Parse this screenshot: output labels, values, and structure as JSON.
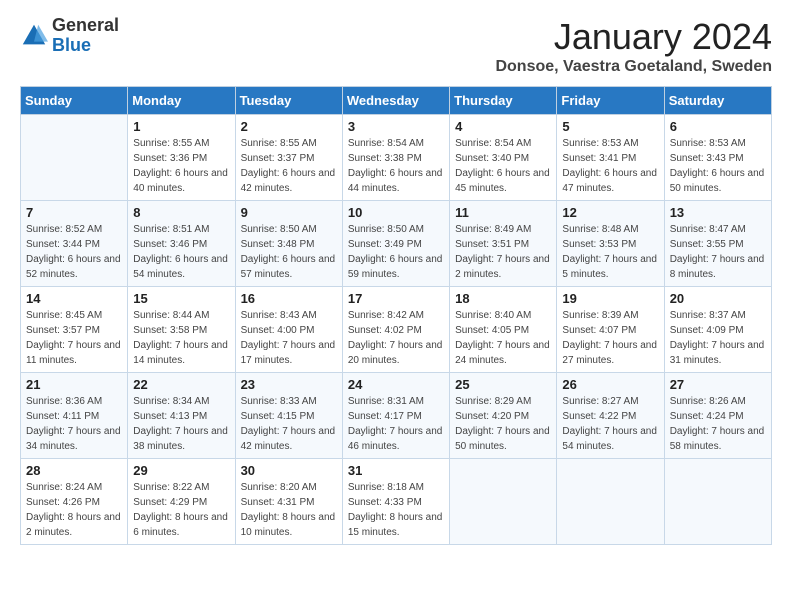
{
  "logo": {
    "general": "General",
    "blue": "Blue"
  },
  "title": "January 2024",
  "location": "Donsoe, Vaestra Goetaland, Sweden",
  "days_of_week": [
    "Sunday",
    "Monday",
    "Tuesday",
    "Wednesday",
    "Thursday",
    "Friday",
    "Saturday"
  ],
  "weeks": [
    [
      {
        "day": "",
        "sunrise": "",
        "sunset": "",
        "daylight": ""
      },
      {
        "day": "1",
        "sunrise": "Sunrise: 8:55 AM",
        "sunset": "Sunset: 3:36 PM",
        "daylight": "Daylight: 6 hours and 40 minutes."
      },
      {
        "day": "2",
        "sunrise": "Sunrise: 8:55 AM",
        "sunset": "Sunset: 3:37 PM",
        "daylight": "Daylight: 6 hours and 42 minutes."
      },
      {
        "day": "3",
        "sunrise": "Sunrise: 8:54 AM",
        "sunset": "Sunset: 3:38 PM",
        "daylight": "Daylight: 6 hours and 44 minutes."
      },
      {
        "day": "4",
        "sunrise": "Sunrise: 8:54 AM",
        "sunset": "Sunset: 3:40 PM",
        "daylight": "Daylight: 6 hours and 45 minutes."
      },
      {
        "day": "5",
        "sunrise": "Sunrise: 8:53 AM",
        "sunset": "Sunset: 3:41 PM",
        "daylight": "Daylight: 6 hours and 47 minutes."
      },
      {
        "day": "6",
        "sunrise": "Sunrise: 8:53 AM",
        "sunset": "Sunset: 3:43 PM",
        "daylight": "Daylight: 6 hours and 50 minutes."
      }
    ],
    [
      {
        "day": "7",
        "sunrise": "Sunrise: 8:52 AM",
        "sunset": "Sunset: 3:44 PM",
        "daylight": "Daylight: 6 hours and 52 minutes."
      },
      {
        "day": "8",
        "sunrise": "Sunrise: 8:51 AM",
        "sunset": "Sunset: 3:46 PM",
        "daylight": "Daylight: 6 hours and 54 minutes."
      },
      {
        "day": "9",
        "sunrise": "Sunrise: 8:50 AM",
        "sunset": "Sunset: 3:48 PM",
        "daylight": "Daylight: 6 hours and 57 minutes."
      },
      {
        "day": "10",
        "sunrise": "Sunrise: 8:50 AM",
        "sunset": "Sunset: 3:49 PM",
        "daylight": "Daylight: 6 hours and 59 minutes."
      },
      {
        "day": "11",
        "sunrise": "Sunrise: 8:49 AM",
        "sunset": "Sunset: 3:51 PM",
        "daylight": "Daylight: 7 hours and 2 minutes."
      },
      {
        "day": "12",
        "sunrise": "Sunrise: 8:48 AM",
        "sunset": "Sunset: 3:53 PM",
        "daylight": "Daylight: 7 hours and 5 minutes."
      },
      {
        "day": "13",
        "sunrise": "Sunrise: 8:47 AM",
        "sunset": "Sunset: 3:55 PM",
        "daylight": "Daylight: 7 hours and 8 minutes."
      }
    ],
    [
      {
        "day": "14",
        "sunrise": "Sunrise: 8:45 AM",
        "sunset": "Sunset: 3:57 PM",
        "daylight": "Daylight: 7 hours and 11 minutes."
      },
      {
        "day": "15",
        "sunrise": "Sunrise: 8:44 AM",
        "sunset": "Sunset: 3:58 PM",
        "daylight": "Daylight: 7 hours and 14 minutes."
      },
      {
        "day": "16",
        "sunrise": "Sunrise: 8:43 AM",
        "sunset": "Sunset: 4:00 PM",
        "daylight": "Daylight: 7 hours and 17 minutes."
      },
      {
        "day": "17",
        "sunrise": "Sunrise: 8:42 AM",
        "sunset": "Sunset: 4:02 PM",
        "daylight": "Daylight: 7 hours and 20 minutes."
      },
      {
        "day": "18",
        "sunrise": "Sunrise: 8:40 AM",
        "sunset": "Sunset: 4:05 PM",
        "daylight": "Daylight: 7 hours and 24 minutes."
      },
      {
        "day": "19",
        "sunrise": "Sunrise: 8:39 AM",
        "sunset": "Sunset: 4:07 PM",
        "daylight": "Daylight: 7 hours and 27 minutes."
      },
      {
        "day": "20",
        "sunrise": "Sunrise: 8:37 AM",
        "sunset": "Sunset: 4:09 PM",
        "daylight": "Daylight: 7 hours and 31 minutes."
      }
    ],
    [
      {
        "day": "21",
        "sunrise": "Sunrise: 8:36 AM",
        "sunset": "Sunset: 4:11 PM",
        "daylight": "Daylight: 7 hours and 34 minutes."
      },
      {
        "day": "22",
        "sunrise": "Sunrise: 8:34 AM",
        "sunset": "Sunset: 4:13 PM",
        "daylight": "Daylight: 7 hours and 38 minutes."
      },
      {
        "day": "23",
        "sunrise": "Sunrise: 8:33 AM",
        "sunset": "Sunset: 4:15 PM",
        "daylight": "Daylight: 7 hours and 42 minutes."
      },
      {
        "day": "24",
        "sunrise": "Sunrise: 8:31 AM",
        "sunset": "Sunset: 4:17 PM",
        "daylight": "Daylight: 7 hours and 46 minutes."
      },
      {
        "day": "25",
        "sunrise": "Sunrise: 8:29 AM",
        "sunset": "Sunset: 4:20 PM",
        "daylight": "Daylight: 7 hours and 50 minutes."
      },
      {
        "day": "26",
        "sunrise": "Sunrise: 8:27 AM",
        "sunset": "Sunset: 4:22 PM",
        "daylight": "Daylight: 7 hours and 54 minutes."
      },
      {
        "day": "27",
        "sunrise": "Sunrise: 8:26 AM",
        "sunset": "Sunset: 4:24 PM",
        "daylight": "Daylight: 7 hours and 58 minutes."
      }
    ],
    [
      {
        "day": "28",
        "sunrise": "Sunrise: 8:24 AM",
        "sunset": "Sunset: 4:26 PM",
        "daylight": "Daylight: 8 hours and 2 minutes."
      },
      {
        "day": "29",
        "sunrise": "Sunrise: 8:22 AM",
        "sunset": "Sunset: 4:29 PM",
        "daylight": "Daylight: 8 hours and 6 minutes."
      },
      {
        "day": "30",
        "sunrise": "Sunrise: 8:20 AM",
        "sunset": "Sunset: 4:31 PM",
        "daylight": "Daylight: 8 hours and 10 minutes."
      },
      {
        "day": "31",
        "sunrise": "Sunrise: 8:18 AM",
        "sunset": "Sunset: 4:33 PM",
        "daylight": "Daylight: 8 hours and 15 minutes."
      },
      {
        "day": "",
        "sunrise": "",
        "sunset": "",
        "daylight": ""
      },
      {
        "day": "",
        "sunrise": "",
        "sunset": "",
        "daylight": ""
      },
      {
        "day": "",
        "sunrise": "",
        "sunset": "",
        "daylight": ""
      }
    ]
  ]
}
